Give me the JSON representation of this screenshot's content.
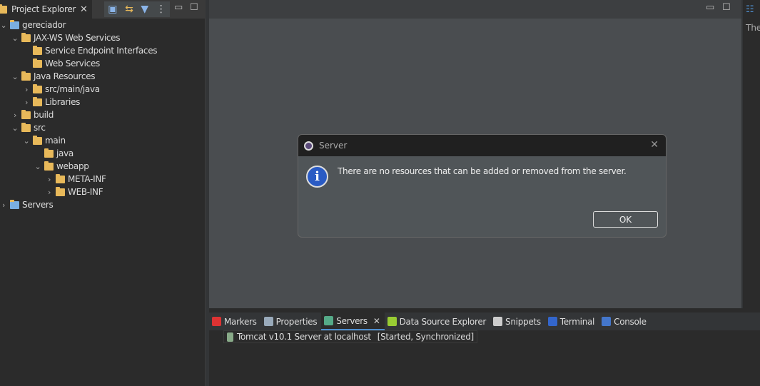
{
  "project_explorer": {
    "tab_label": "Project Explorer",
    "tree": [
      {
        "label": "gereciador",
        "level": 0,
        "expanded": true,
        "icon": "web-project-icon"
      },
      {
        "label": "JAX-WS Web Services",
        "level": 1,
        "expanded": true,
        "icon": "jaxws-icon"
      },
      {
        "label": "Service Endpoint Interfaces",
        "level": 2,
        "expanded": null,
        "icon": "interface-folder-icon"
      },
      {
        "label": "Web Services",
        "level": 2,
        "expanded": null,
        "icon": "webservice-folder-icon"
      },
      {
        "label": "Java Resources",
        "level": 1,
        "expanded": true,
        "icon": "java-resources-icon"
      },
      {
        "label": "src/main/java",
        "level": 2,
        "expanded": false,
        "icon": "package-folder-icon"
      },
      {
        "label": "Libraries",
        "level": 2,
        "expanded": false,
        "icon": "libraries-icon"
      },
      {
        "label": "build",
        "level": 1,
        "expanded": false,
        "icon": "folder-icon"
      },
      {
        "label": "src",
        "level": 1,
        "expanded": true,
        "icon": "folder-icon"
      },
      {
        "label": "main",
        "level": 2,
        "expanded": true,
        "icon": "folder-icon"
      },
      {
        "label": "java",
        "level": 3,
        "expanded": null,
        "icon": "folder-icon"
      },
      {
        "label": "webapp",
        "level": 3,
        "expanded": true,
        "icon": "folder-icon"
      },
      {
        "label": "META-INF",
        "level": 4,
        "expanded": false,
        "icon": "folder-icon"
      },
      {
        "label": "WEB-INF",
        "level": 4,
        "expanded": false,
        "icon": "folder-icon"
      },
      {
        "label": "Servers",
        "level": 0,
        "expanded": false,
        "icon": "folder-icon"
      }
    ]
  },
  "right_panel": {
    "text": "The"
  },
  "bottom": {
    "tabs": [
      {
        "label": "Markers",
        "icon": "markers-icon",
        "color": "#d33"
      },
      {
        "label": "Properties",
        "icon": "properties-icon",
        "color": "#9ab"
      },
      {
        "label": "Servers",
        "icon": "servers-icon",
        "color": "#5a8",
        "active": true
      },
      {
        "label": "Data Source Explorer",
        "icon": "datasource-icon",
        "color": "#9c3"
      },
      {
        "label": "Snippets",
        "icon": "snippets-icon",
        "color": "#ccc"
      },
      {
        "label": "Terminal",
        "icon": "terminal-icon",
        "color": "#36c"
      },
      {
        "label": "Console",
        "icon": "console-icon",
        "color": "#47c"
      }
    ],
    "server_entry": {
      "name": "Tomcat v10.1 Server at localhost",
      "status": "[Started, Synchronized]"
    }
  },
  "dialog": {
    "title": "Server",
    "message": "There are no resources that can be added or removed from the server.",
    "ok_label": "OK",
    "info_color": "#2a5bc4"
  }
}
